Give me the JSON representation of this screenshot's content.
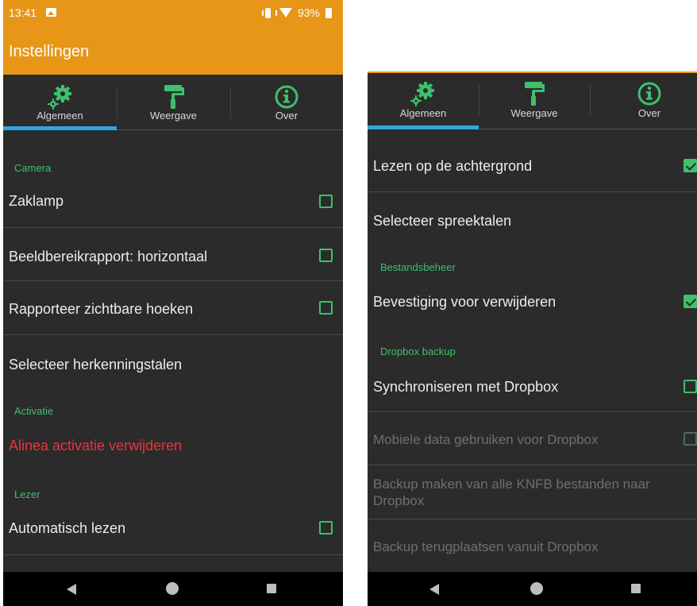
{
  "status": {
    "time": "13:41",
    "battery": "93%"
  },
  "app": {
    "title": "Instellingen"
  },
  "tabs": [
    {
      "label": "Algemeen",
      "icon": "gears-icon",
      "selected": true
    },
    {
      "label": "Weergave",
      "icon": "paint-roller-icon",
      "selected": false
    },
    {
      "label": "Over",
      "icon": "info-icon",
      "selected": false
    }
  ],
  "left": {
    "sections": {
      "camera": "Camera",
      "activation": "Activatie",
      "reader": "Lezer"
    },
    "rows": {
      "flashlight": {
        "label": "Zaklamp",
        "checked": false
      },
      "aspect": {
        "label": "Beeldbereikrapport: horizontaal",
        "checked": false
      },
      "corners": {
        "label": "Rapporteer zichtbare hoeken",
        "checked": false
      },
      "recognition_languages": {
        "label": "Selecteer herkenningstalen"
      },
      "remove_activation": {
        "label": "Alinea activatie verwijderen"
      },
      "auto_read": {
        "label": "Automatisch lezen",
        "checked": false
      }
    }
  },
  "right": {
    "sections": {
      "file_management": "Bestandsbeheer",
      "dropbox_backup": "Dropbox backup"
    },
    "rows": {
      "background_reading": {
        "label": "Lezen op de achtergrond",
        "checked": true
      },
      "speech_languages": {
        "label": "Selecteer spreektalen"
      },
      "confirm_delete": {
        "label": "Bevestiging voor verwijderen",
        "checked": true
      },
      "sync_dropbox": {
        "label": "Synchroniseren met Dropbox",
        "checked": false
      },
      "mobile_data": {
        "label": "Mobiele data gebruiken voor Dropbox",
        "checked": false,
        "enabled": false
      },
      "backup_all": {
        "label_line1": "Backup maken van alle KNFB bestanden naar",
        "label_line2": "Dropbox",
        "enabled": false
      },
      "restore_backup": {
        "label": "Backup terugplaatsen vanuit Dropbox",
        "enabled": false
      }
    }
  },
  "colors": {
    "accent": "#e89617",
    "section": "#3fc06b",
    "tab_indicator": "#2fa6de",
    "danger": "#e8353e",
    "background": "#2b2b2b"
  }
}
